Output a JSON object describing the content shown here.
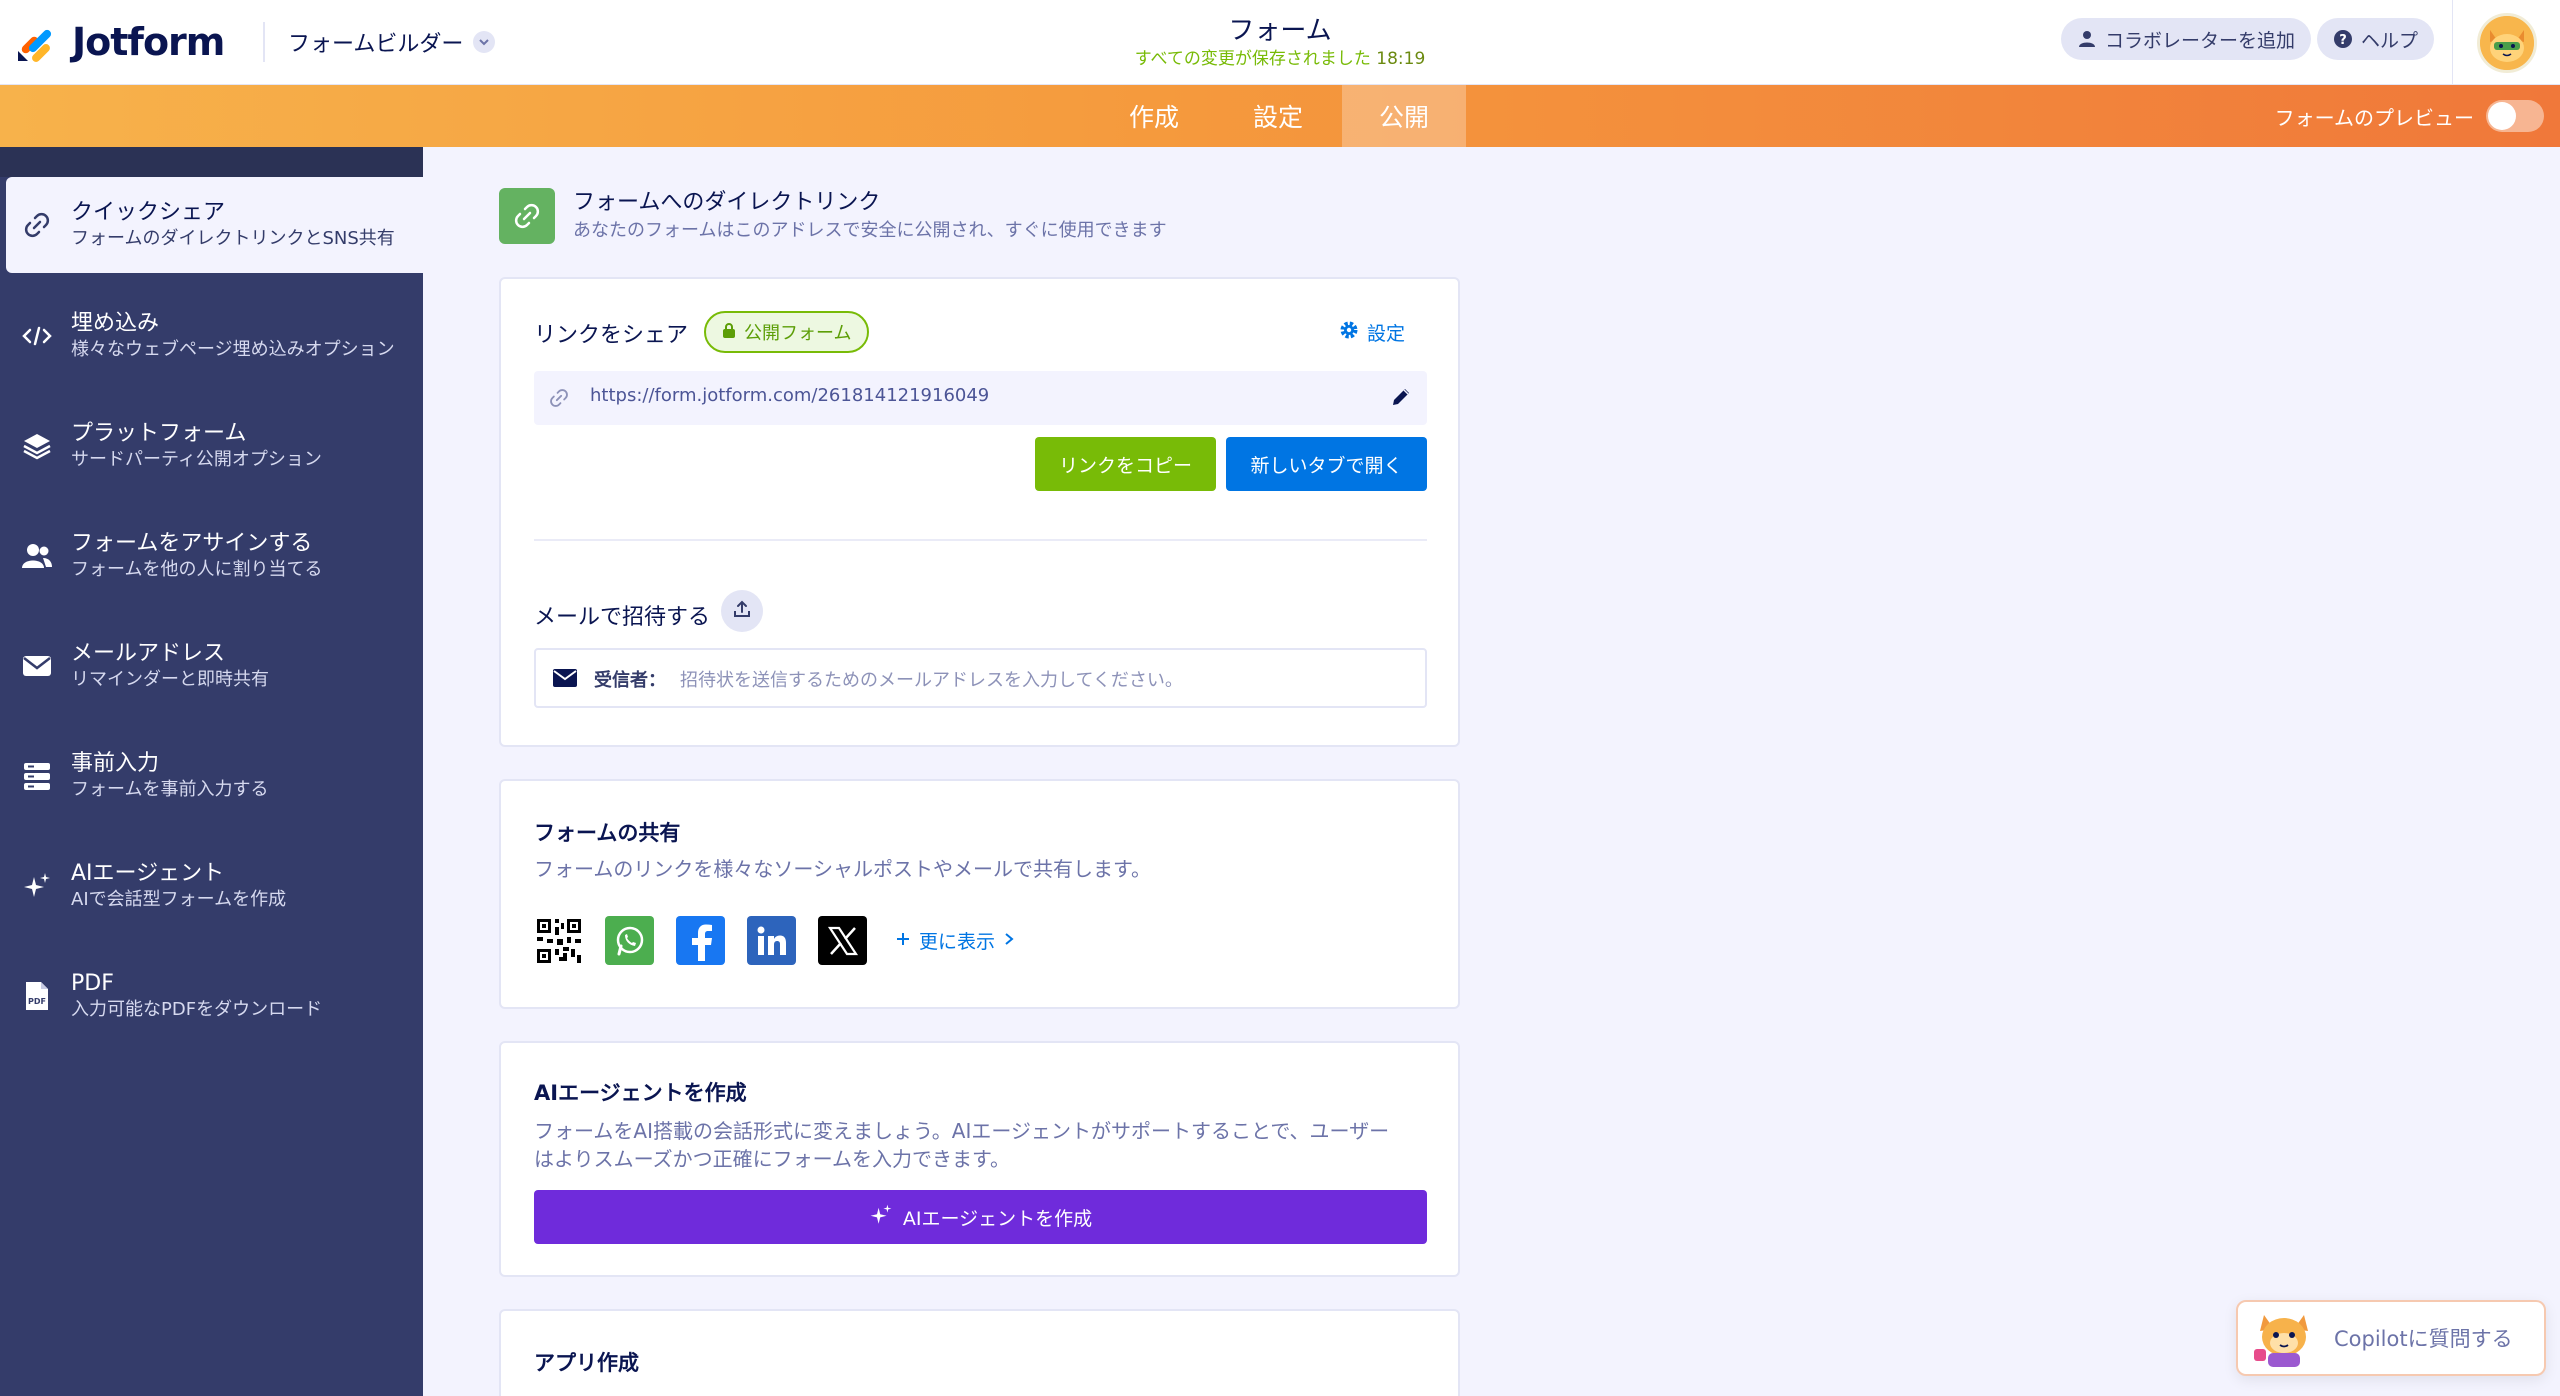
{
  "header": {
    "brand": "Jotform",
    "builder_selector": "フォームビルダー",
    "form_title": "フォーム",
    "save_status": "すべての変更が保存されました",
    "save_time": "18:19",
    "add_collaborator": "コラボレーターを追加",
    "help": "ヘルプ"
  },
  "nav": {
    "tabs": [
      {
        "label": "作成",
        "active": false
      },
      {
        "label": "設定",
        "active": false
      },
      {
        "label": "公開",
        "active": true
      }
    ],
    "preview_label": "フォームのプレビュー",
    "preview_on": false
  },
  "sidebar": {
    "items": [
      {
        "title": "クイックシェア",
        "subtitle": "フォームのダイレクトリンクとSNS共有",
        "icon": "link-icon",
        "active": true
      },
      {
        "title": "埋め込み",
        "subtitle": "様々なウェブページ埋め込みオプション",
        "icon": "code-icon",
        "active": false
      },
      {
        "title": "プラットフォーム",
        "subtitle": "サードパーティ公開オプション",
        "icon": "layers-icon",
        "active": false
      },
      {
        "title": "フォームをアサインする",
        "subtitle": "フォームを他の人に割り当てる",
        "icon": "users-icon",
        "active": false
      },
      {
        "title": "メールアドレス",
        "subtitle": "リマインダーと即時共有",
        "icon": "envelope-icon",
        "active": false
      },
      {
        "title": "事前入力",
        "subtitle": "フォームを事前入力する",
        "icon": "prefill-icon",
        "active": false
      },
      {
        "title": "AIエージェント",
        "subtitle": "AIで会話型フォームを作成",
        "icon": "sparkle-icon",
        "active": false
      },
      {
        "title": "PDF",
        "subtitle": "入力可能なPDFをダウンロード",
        "icon": "pdf-icon",
        "active": false
      }
    ]
  },
  "main": {
    "section_title": "フォームへのダイレクトリンク",
    "section_subtitle": "あなたのフォームはこのアドレスで安全に公開され、すぐに使用できます",
    "share": {
      "label": "リンクをシェア",
      "badge": "公開フォーム",
      "settings": "設定",
      "url": "https://form.jotform.com/261814121916049",
      "copy_button": "リンクをコピー",
      "open_button": "新しいタブで開く",
      "invite_label": "メールで招待する",
      "recipient_label": "受信者：",
      "recipient_placeholder": "招待状を送信するためのメールアドレスを入力してください。"
    },
    "social": {
      "title": "フォームの共有",
      "description": "フォームのリンクを様々なソーシャルポストやメールで共有します。",
      "more": "更に表示",
      "icons": [
        "qr-code-icon",
        "whatsapp-icon",
        "facebook-icon",
        "linkedin-icon",
        "x-icon"
      ]
    },
    "ai_agent": {
      "title": "AIエージェントを作成",
      "description_line1": "フォームをAI搭載の会話形式に変えましょう。AIエージェントがサポートすることで、ユーザー",
      "description_line2": "はよりスムーズかつ正確にフォームを入力できます。",
      "button": "AIエージェントを作成"
    },
    "app": {
      "title": "アプリ作成"
    }
  },
  "copilot": {
    "label": "Copilotに質問する"
  },
  "colors": {
    "navy": "#0a1551",
    "sidebar": "#343c6a",
    "green": "#78bb07",
    "blue": "#0075e3",
    "purple": "#6f2bdb",
    "orange_start": "#f7b24b",
    "orange_end": "#f0783a"
  }
}
